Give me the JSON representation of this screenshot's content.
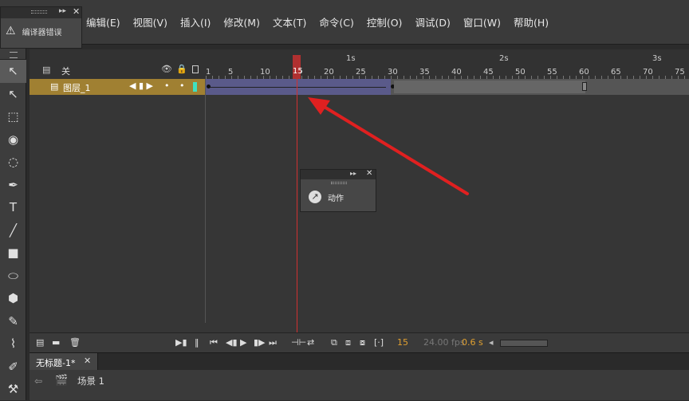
{
  "menu": {
    "items": [
      "编辑(E)",
      "视图(V)",
      "插入(I)",
      "修改(M)",
      "文本(T)",
      "命令(C)",
      "控制(O)",
      "调试(D)",
      "窗口(W)",
      "帮助(H)"
    ]
  },
  "error_panel": {
    "label": "编译器错误",
    "warn_icon": "⚠",
    "collapse_icon": "▸▸",
    "close_icon": "✕"
  },
  "tools": [
    {
      "name": "selection-tool-icon",
      "glyph": "↖",
      "selected": true
    },
    {
      "name": "subselection-tool-icon",
      "glyph": "↖"
    },
    {
      "name": "free-transform-tool-icon",
      "glyph": "⬚"
    },
    {
      "name": "3d-rotation-tool-icon",
      "glyph": "◉"
    },
    {
      "name": "lasso-tool-icon",
      "glyph": "◌"
    },
    {
      "name": "pen-tool-icon",
      "glyph": "✒"
    },
    {
      "name": "text-tool-icon",
      "glyph": "T"
    },
    {
      "name": "line-tool-icon",
      "glyph": "╱"
    },
    {
      "name": "rectangle-tool-icon",
      "glyph": "■"
    },
    {
      "name": "oval-tool-icon",
      "glyph": "⬭"
    },
    {
      "name": "polystar-tool-icon",
      "glyph": "⬢"
    },
    {
      "name": "pencil-tool-icon",
      "glyph": "✎"
    },
    {
      "name": "brush-tool-icon",
      "glyph": "⌇"
    },
    {
      "name": "paint-brush-tool-icon",
      "glyph": "✐"
    },
    {
      "name": "bone-tool-icon",
      "glyph": "⚒"
    }
  ],
  "timeline": {
    "header_label": "关",
    "eye_icon": "👁",
    "lock_icon": "🔒",
    "seconds": [
      {
        "label": "1s",
        "pos": 0
      },
      {
        "label": "2s",
        "pos": 1
      },
      {
        "label": "3s",
        "pos": 2
      }
    ],
    "frame_numbers": [
      "1",
      "5",
      "10",
      "15",
      "20",
      "25",
      "30",
      "35",
      "40",
      "45",
      "50",
      "55",
      "60",
      "65",
      "70",
      "75"
    ],
    "playhead_frame": "15",
    "layer": {
      "name": "图层_1",
      "controls": "◀ ▮ ▶",
      "dot": "•"
    },
    "status": {
      "current_frame": "15",
      "fps": "24.00 fps",
      "time": "0.6 s"
    }
  },
  "actions_panel": {
    "label": "动作",
    "icon": "↗",
    "collapse_icon": "▸▸",
    "close_icon": "✕"
  },
  "doc_tab": {
    "title": "无标题-1*",
    "close_icon": "✕"
  },
  "scene": {
    "label": "场景 1",
    "back_icon": "⇦",
    "clapper_icon": "🎬"
  },
  "colors": {
    "layer_highlight": "#a08032",
    "tween": "#5a5a8a",
    "playhead": "#d03030",
    "annotation_arrow": "#e02020"
  }
}
